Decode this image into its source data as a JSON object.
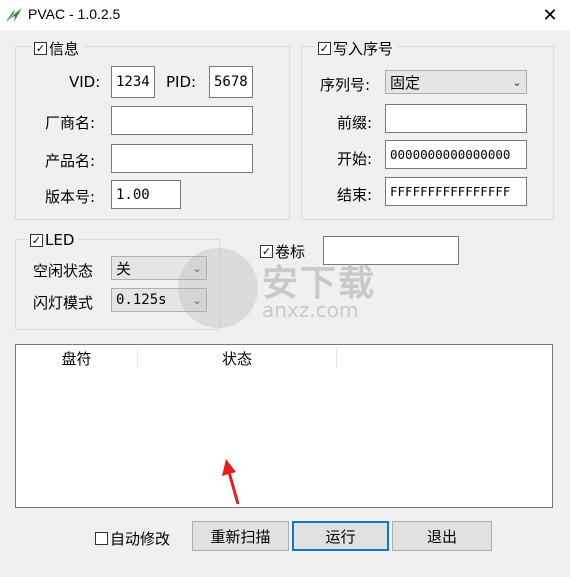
{
  "window": {
    "title": "PVAC - 1.0.2.5",
    "close_glyph": "✕"
  },
  "info_group": {
    "title": "信息",
    "checked": true,
    "vid_label": "VID:",
    "vid_value": "1234",
    "pid_label": "PID:",
    "pid_value": "5678",
    "manufacturer_label": "厂商名:",
    "manufacturer_value": "",
    "product_label": "产品名:",
    "product_value": "",
    "version_label": "版本号:",
    "version_value": "1.00"
  },
  "serial_group": {
    "title": "写入序号",
    "checked": true,
    "serial_label": "序列号:",
    "serial_mode": "固定",
    "prefix_label": "前缀:",
    "prefix_value": "",
    "start_label": "开始:",
    "start_value": "0000000000000000",
    "end_label": "结束:",
    "end_value": "FFFFFFFFFFFFFFFF"
  },
  "led_group": {
    "title": "LED",
    "checked": true,
    "idle_label": "空闲状态",
    "idle_value": "关",
    "blink_label": "闪灯模式",
    "blink_value": "0.125s"
  },
  "volume": {
    "label": "卷标",
    "checked": true,
    "value": ""
  },
  "table": {
    "columns": [
      "盘符",
      "状态"
    ]
  },
  "footer": {
    "auto_modify_label": "自动修改",
    "auto_modify_checked": false,
    "rescan_label": "重新扫描",
    "run_label": "运行",
    "exit_label": "退出"
  },
  "watermark": {
    "cn": "安下载",
    "url": "anxz.com"
  },
  "icons": {
    "check": "✓",
    "dropdown": "⌄",
    "app": "app-logo-icon",
    "arrow": "red-arrow-icon"
  },
  "colors": {
    "focus_border": "#0078d7",
    "arrow": "#e02020"
  }
}
